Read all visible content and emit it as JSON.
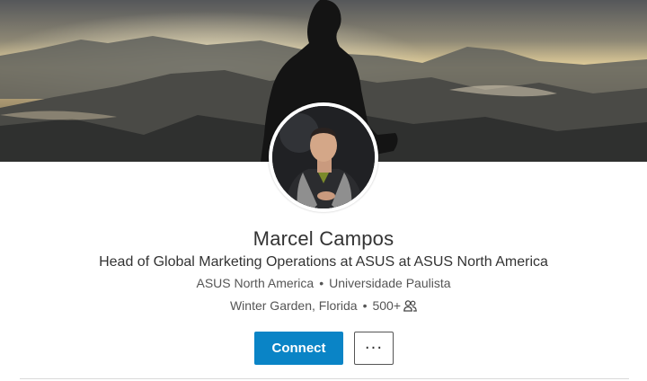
{
  "profile": {
    "name": "Marcel Campos",
    "headline": "Head of Global Marketing Operations at ASUS at ASUS North America",
    "company": "ASUS North America",
    "education": "Universidade Paulista",
    "location": "Winter Garden, Florida",
    "connections": "500+",
    "separator": "•"
  },
  "actions": {
    "connect_label": "Connect",
    "more_label": "···"
  },
  "icons": {
    "connections": "people-icon",
    "more": "more-horizontal-icon"
  },
  "colors": {
    "accent": "#0a84c6",
    "text_primary": "#333333",
    "text_secondary": "#555555"
  }
}
